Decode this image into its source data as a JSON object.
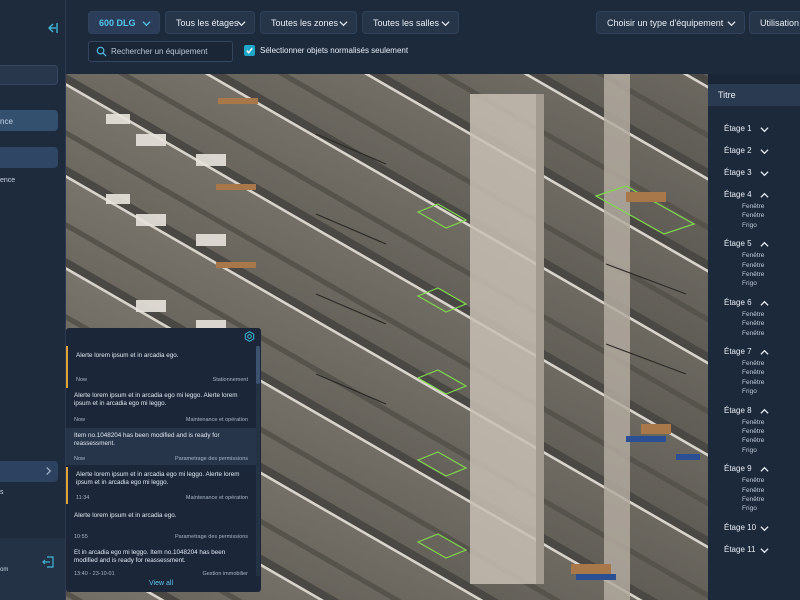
{
  "topbar": {
    "building": "600 DLG",
    "floors_filter": "Tous les étages",
    "zones_filter": "Toutes les zones",
    "rooms_filter": "Toutes les salles",
    "equipment_type": "Choisir un type d'équipement",
    "usage_label": "Utilisation g",
    "search_placeholder": "Rechercher un équipement",
    "normalized_only_label": "Sélectionner objets normalisés seulement"
  },
  "sidebar": {
    "item_1_fragment": "nce",
    "item_2_fragment": "ence",
    "item_3_fragment": "s",
    "item_4_fragment": "om"
  },
  "notifications": {
    "view_all": "View all",
    "items": [
      {
        "message": "Alerte lorem ipsum et in arcadia ego.",
        "time": "Now",
        "category": "Stationnement"
      },
      {
        "message": "Alerte lorem ipsum et in arcadia ego mi leggo. Alerte lorem ipsum et in arcadia ego mi leggo.",
        "time": "Now",
        "category": "Maintenance et opération"
      },
      {
        "message": "Item no.1048204 has been modified and is ready for reassessment.",
        "time": "Now",
        "category": "Parametrage des permissions"
      },
      {
        "message": "Alerte lorem ipsum et in arcadia ego mi leggo. Alerte lorem ipsum et in arcadia ego mi leggo.",
        "time": "11:34",
        "category": "Maintenance et opération"
      },
      {
        "message": "Alerte lorem ipsum et in arcadia ego.",
        "time": "10:55",
        "category": "Parametrage des permissions"
      },
      {
        "message": "Et in arcadia ego mi leggo. Item no.1048204 has been modified and is ready for reassessment.",
        "time": "13:40 - 23-10-01",
        "category": "Gestion immobilier"
      }
    ]
  },
  "floors_panel": {
    "title": "Titre",
    "floors": [
      {
        "label": "Étage 1",
        "expanded": false,
        "items": []
      },
      {
        "label": "Étage 2",
        "expanded": false,
        "items": []
      },
      {
        "label": "Étage 3",
        "expanded": false,
        "items": []
      },
      {
        "label": "Étage 4",
        "expanded": true,
        "items": [
          "Fenêtre",
          "Fenêtre",
          "Frigo"
        ]
      },
      {
        "label": "Étage 5",
        "expanded": true,
        "items": [
          "Fenêtre",
          "Fenêtre",
          "Fenêtre",
          "Frigo"
        ]
      },
      {
        "label": "Étage 6",
        "expanded": true,
        "items": [
          "Fenêtre",
          "Fenêtre",
          "Fenêtre"
        ]
      },
      {
        "label": "Étage 7",
        "expanded": true,
        "items": [
          "Fenêtre",
          "Fenêtre",
          "Fenêtre",
          "Frigo"
        ]
      },
      {
        "label": "Étage 8",
        "expanded": true,
        "items": [
          "Fenêtre",
          "Fenêtre",
          "Fenêtre",
          "Frigo"
        ]
      },
      {
        "label": "Étage 9",
        "expanded": true,
        "items": [
          "Fenêtre",
          "Fenêtre",
          "Fenêtre",
          "Frigo"
        ]
      },
      {
        "label": "Étage 10",
        "expanded": false,
        "items": []
      },
      {
        "label": "Étage 11",
        "expanded": false,
        "items": []
      }
    ]
  },
  "colors": {
    "accent": "#3fb6d9",
    "warning_bar": "#e0a43a",
    "highlight_outline": "#7fd94a"
  },
  "icons": [
    "collapse-sidebar-icon",
    "search-icon",
    "check-icon",
    "chevron-down-icon",
    "chevron-up-icon",
    "hexagon-settings-icon",
    "logout-icon",
    "chevron-right-icon"
  ]
}
